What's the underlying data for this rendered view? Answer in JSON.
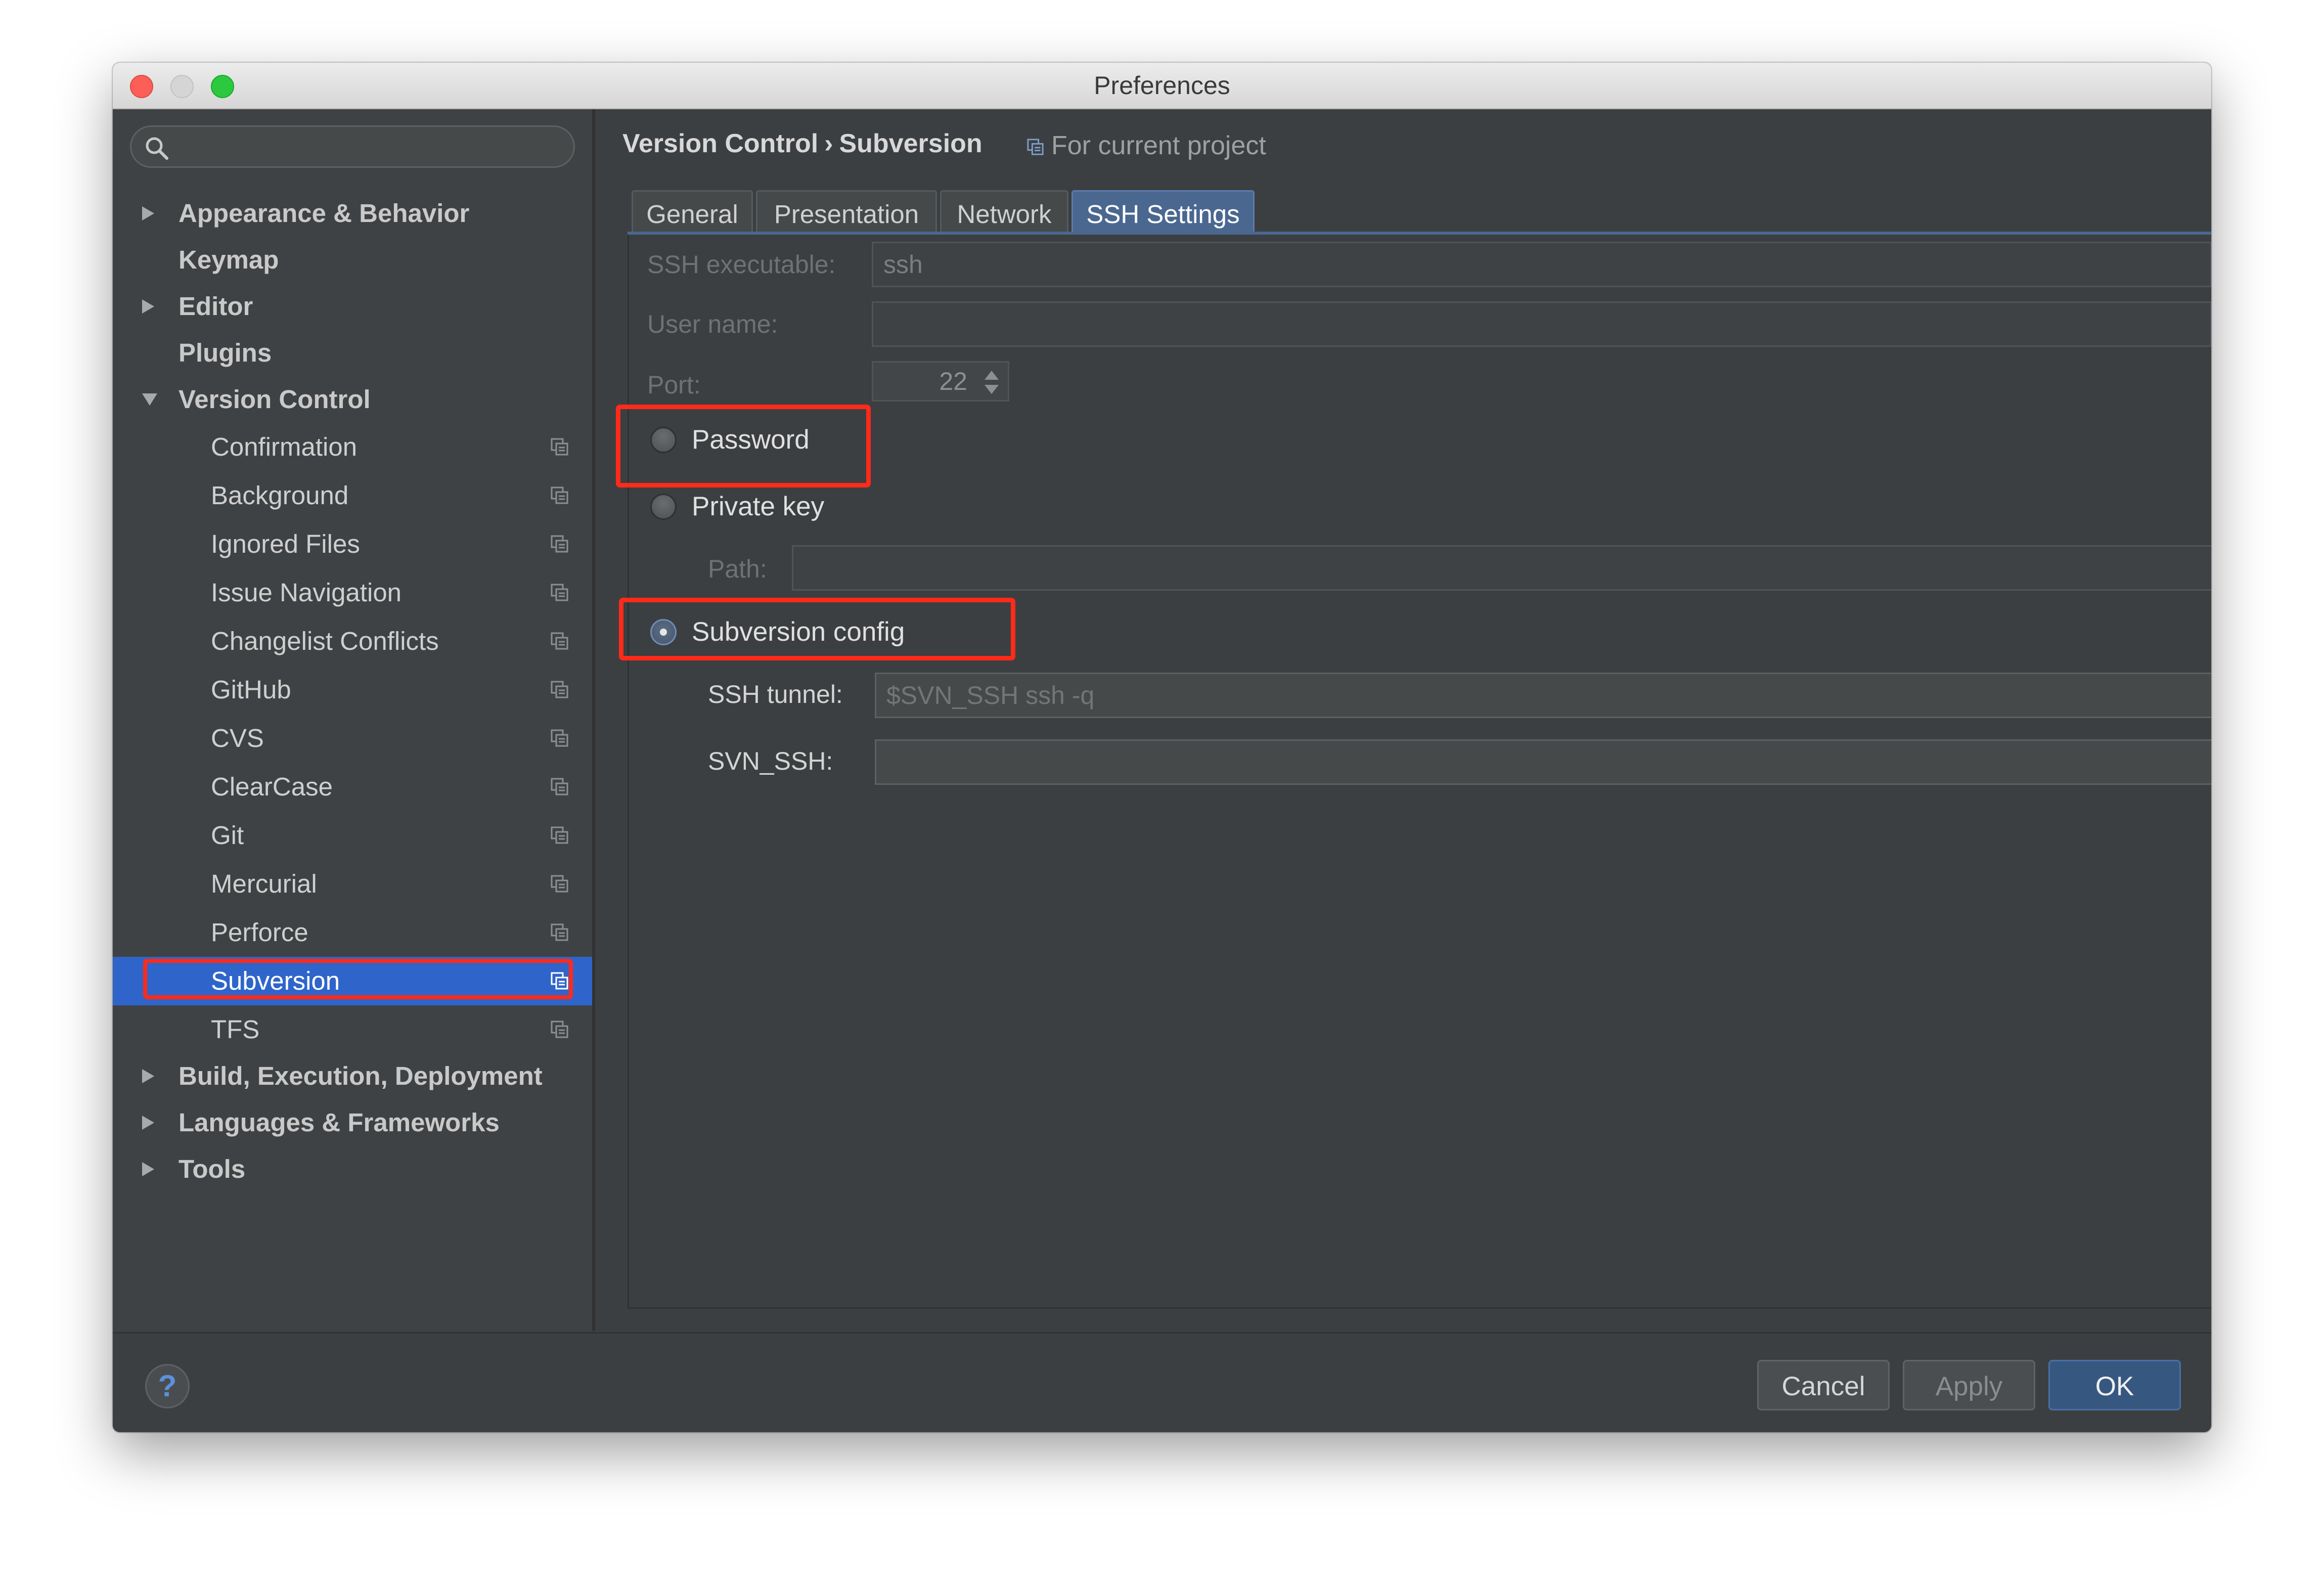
{
  "window": {
    "title": "Preferences"
  },
  "sidebar": {
    "search_placeholder": "",
    "items": [
      {
        "label": "Appearance & Behavior",
        "level": 0,
        "arrow": "collapsed"
      },
      {
        "label": "Keymap",
        "level": 0,
        "arrow": "none"
      },
      {
        "label": "Editor",
        "level": 0,
        "arrow": "collapsed"
      },
      {
        "label": "Plugins",
        "level": 0,
        "arrow": "none"
      },
      {
        "label": "Version Control",
        "level": 0,
        "arrow": "expanded"
      },
      {
        "label": "Confirmation",
        "level": 1,
        "project_icon": true
      },
      {
        "label": "Background",
        "level": 1,
        "project_icon": true
      },
      {
        "label": "Ignored Files",
        "level": 1,
        "project_icon": true
      },
      {
        "label": "Issue Navigation",
        "level": 1,
        "project_icon": true
      },
      {
        "label": "Changelist Conflicts",
        "level": 1,
        "project_icon": true
      },
      {
        "label": "GitHub",
        "level": 1,
        "project_icon": true
      },
      {
        "label": "CVS",
        "level": 1,
        "project_icon": true
      },
      {
        "label": "ClearCase",
        "level": 1,
        "project_icon": true
      },
      {
        "label": "Git",
        "level": 1,
        "project_icon": true
      },
      {
        "label": "Mercurial",
        "level": 1,
        "project_icon": true
      },
      {
        "label": "Perforce",
        "level": 1,
        "project_icon": true
      },
      {
        "label": "Subversion",
        "level": 1,
        "project_icon": true,
        "selected": true
      },
      {
        "label": "TFS",
        "level": 1,
        "project_icon": true
      },
      {
        "label": "Build, Execution, Deployment",
        "level": 0,
        "arrow": "collapsed"
      },
      {
        "label": "Languages & Frameworks",
        "level": 0,
        "arrow": "collapsed"
      },
      {
        "label": "Tools",
        "level": 0,
        "arrow": "collapsed"
      }
    ]
  },
  "header": {
    "crumb_parent": "Version Control",
    "crumb_separator": "›",
    "crumb_current": "Subversion",
    "scope": "For current project"
  },
  "tabs": [
    {
      "label": "General",
      "active": false
    },
    {
      "label": "Presentation",
      "active": false
    },
    {
      "label": "Network",
      "active": false
    },
    {
      "label": "SSH Settings",
      "active": true
    }
  ],
  "ssh": {
    "executable_label": "SSH executable:",
    "executable_value": "ssh",
    "username_label": "User name:",
    "username_value": "",
    "port_label": "Port:",
    "port_value": "22",
    "auth_options": [
      {
        "label": "Password",
        "checked": false
      },
      {
        "label": "Private key",
        "checked": false
      },
      {
        "label": "Subversion config",
        "checked": true
      }
    ],
    "path_label": "Path:",
    "path_value": "",
    "tunnel_label": "SSH tunnel:",
    "tunnel_placeholder": "$SVN_SSH ssh -q",
    "svn_ssh_label": "SVN_SSH:",
    "svn_ssh_value": ""
  },
  "footer": {
    "help": "?",
    "cancel": "Cancel",
    "apply": "Apply",
    "ok": "OK"
  },
  "colors": {
    "selection": "#2f65ca",
    "annotation": "#ff2a1a",
    "active_tab": "#4a6790"
  },
  "icons": [
    "search-icon",
    "tree-arrow-icon",
    "project-settings-icon",
    "spinner-icon",
    "help-icon"
  ]
}
